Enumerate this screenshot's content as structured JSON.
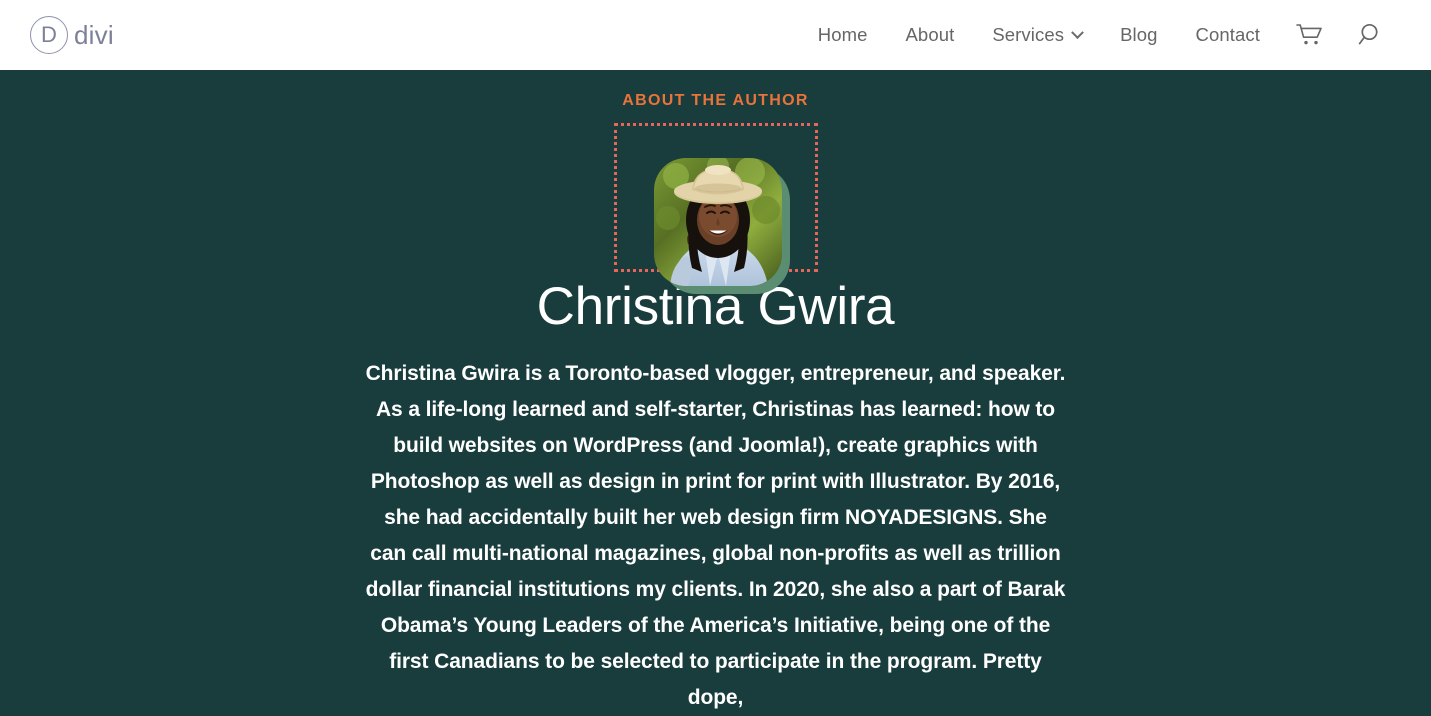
{
  "header": {
    "logo": {
      "mark": "D",
      "word": "divi"
    },
    "nav_items": [
      {
        "label": "Home",
        "has_dropdown": false
      },
      {
        "label": "About",
        "has_dropdown": false
      },
      {
        "label": "Services",
        "has_dropdown": true
      },
      {
        "label": "Blog",
        "has_dropdown": false
      },
      {
        "label": "Contact",
        "has_dropdown": false
      }
    ],
    "cart_icon": "shopping-cart-icon",
    "search_icon": "search-icon"
  },
  "author_section": {
    "eyebrow": "ABOUT THE AUTHOR",
    "name": "Christina Gwira",
    "photo_alt": "Christina Gwira smiling wearing a straw hat outdoors",
    "bio": "Christina Gwira is a Toronto-based vlogger, entrepreneur, and speaker. As a life-long learned and self-starter, Christinas has learned: how to build websites on WordPress (and Joomla!), create graphics with Photoshop as well as design in print for print with Illustrator. By 2016, she had accidentally built her web design firm NOYADESIGNS. She can call multi-national magazines, global non-profits as well as trillion dollar financial institutions my clients. In 2020, she also a part of Barak Obama’s Young Leaders of the America’s Initiative, being one of the first Canadians to be selected to participate in the program. Pretty dope,"
  },
  "colors": {
    "section_background": "#193c3c",
    "accent_orange": "#e8743b",
    "dotted_border": "#e8655a",
    "photo_shadow_green": "#5b8d73",
    "nav_text": "#666666",
    "logo_gray": "#7c8199",
    "body_text": "#ffffff"
  }
}
